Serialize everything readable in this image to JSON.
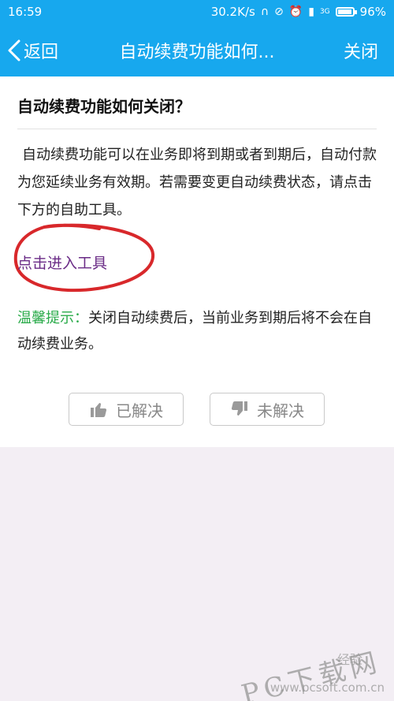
{
  "status_bar": {
    "time": "16:59",
    "net_speed": "30.2K/s",
    "signal_label": "3G",
    "battery_percent": "96%",
    "battery_level": 0.96
  },
  "nav": {
    "back_label": "返回",
    "title": "自动续费功能如何...",
    "close_label": "关闭"
  },
  "content": {
    "question": "自动续费功能如何关闭？",
    "answer": "自动续费功能可以在业务即将到期或者到期后，自动付款为您延续业务有效期。若需要变更自动续费状态，请点击下方的自助工具。",
    "tool_link": "点击进入工具",
    "tip_label": "温馨提示：",
    "tip_text": "关闭自动续费后，当前业务到期后将不会在自动续费业务。"
  },
  "feedback": {
    "solved_label": "已解决",
    "unsolved_label": "未解决"
  },
  "watermark": {
    "brand": "PC下载网",
    "url": "www.pcsoft.com.cn",
    "jingyan": "经验"
  },
  "colors": {
    "header": "#17a8ee",
    "link": "#6a2b86",
    "tip": "#2aab4a",
    "annotation": "#d8282b"
  }
}
